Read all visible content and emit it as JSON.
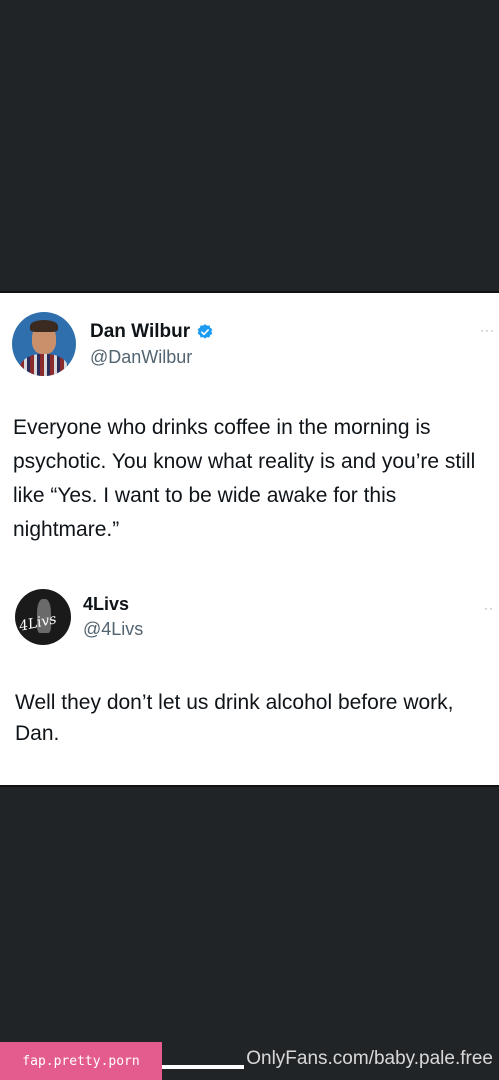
{
  "tweet": {
    "author_name": "Dan Wilbur",
    "author_handle": "@DanWilbur",
    "text": "Everyone who drinks coffee in the morning is psychotic. You know what reality is and you’re still like “Yes. I want to be wide awake for this nightmare.”",
    "verified": true,
    "more_icon": "ellipsis-icon"
  },
  "reply": {
    "author_name": "4Livs",
    "author_handle": "@4Livs",
    "avatar_signature": "4Livs",
    "text": "Well they don’t let us drink alcohol before work, Dan.",
    "more_icon": "ellipsis-icon"
  },
  "footer": {
    "badge_text": "fap.pretty.porn",
    "watermark": "OnlyFans.com/baby.pale.free"
  },
  "colors": {
    "background": "#212426",
    "card": "#ffffff",
    "verified": "#1d9bf0",
    "badge": "#e45c8e"
  }
}
